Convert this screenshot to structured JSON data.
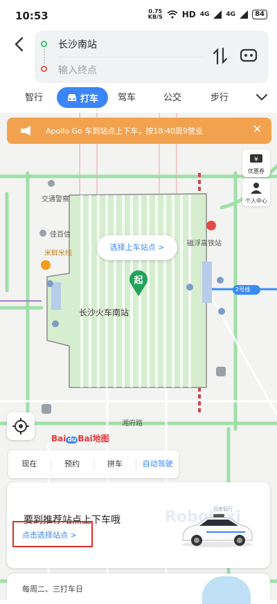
{
  "status_bar": {
    "time": "10:53",
    "speed_value": "0.75",
    "speed_unit": "KB/S",
    "hd": "HD",
    "net1": "4G",
    "net2": "4G",
    "battery": "84"
  },
  "route": {
    "start": "长沙南站",
    "end_placeholder": "输入终点"
  },
  "tabs": [
    {
      "label": "智行"
    },
    {
      "label": "打车",
      "active": true
    },
    {
      "label": "驾车"
    },
    {
      "label": "公交"
    },
    {
      "label": "步行"
    }
  ],
  "notice": {
    "text": "Apollo Go 车到站点上下车，按18:40周9营业"
  },
  "side": {
    "coupon_label": "优惠券",
    "profile_label": "个人中心"
  },
  "map": {
    "pickup_bubble": "选择上车站点 >",
    "pin_label": "起",
    "station_name": "长沙火车南站",
    "label_jiaotong": "交通警察",
    "label_jiabaixin": "佳百信",
    "label_mixian": "米鲜米线",
    "label_metro": "磁浮高铁站",
    "label_line2": "2号线",
    "label_road": "湘府路",
    "baidu_logo": "Bai地图"
  },
  "ride_types": [
    "现在",
    "预约",
    "拼车",
    "自动驾驶"
  ],
  "promo": {
    "title": "要到推荐站点上下车哦",
    "link": "点击选择站点 >",
    "bg_text": "Robotaxi",
    "brand": "百度智行"
  },
  "bottom": {
    "text": "每周二、三打车日"
  },
  "colors": {
    "accent": "#3a85f7",
    "notice": "#f2a24e",
    "highlight": "#d9302a",
    "start_dot": "#2fbf6a",
    "end_dot": "#e55151"
  }
}
